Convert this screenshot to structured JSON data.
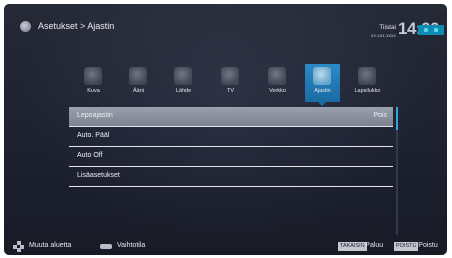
{
  "header": {
    "breadcrumb": "Asetukset > Ajastin",
    "day": "Tiistai",
    "date": "xx.xxx.xxxx",
    "time": "14:00"
  },
  "categories": [
    {
      "label": "Kuva",
      "icon": "picture-icon"
    },
    {
      "label": "Ääni",
      "icon": "speaker-icon"
    },
    {
      "label": "Lähde",
      "icon": "source-icon"
    },
    {
      "label": "TV",
      "icon": "tv-icon"
    },
    {
      "label": "Verkko",
      "icon": "globe-icon"
    },
    {
      "label": "Ajastin",
      "icon": "timer-icon",
      "active": true
    },
    {
      "label": "Lapsilukko",
      "icon": "lock-icon"
    }
  ],
  "menu": {
    "items": [
      {
        "label": "Lepoajastin",
        "value": "Pois"
      },
      {
        "label": "Auto. Pääl",
        "value": ""
      },
      {
        "label": "Auto Off",
        "value": ""
      },
      {
        "label": "Lisäasetukset",
        "value": ""
      }
    ]
  },
  "footer": {
    "navigate": "Muuta aluetta",
    "switch": "Vaihtotila",
    "back_key": "TAKAISIN",
    "back": "- Paluu",
    "exit_key": "POISTU",
    "exit": "- Poistu"
  },
  "colors": {
    "accent": "#1a6aa3",
    "highlight_row": "#8a909d",
    "background": "#1f2331"
  }
}
